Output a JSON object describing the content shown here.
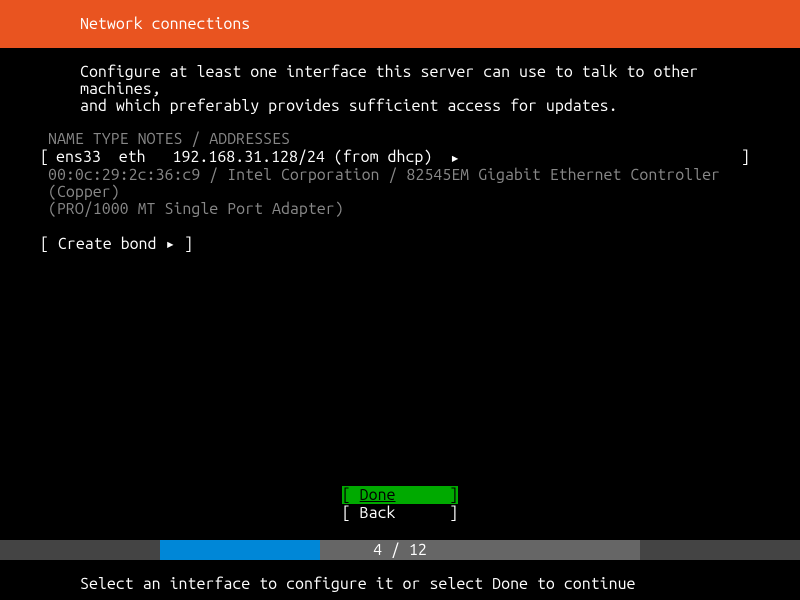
{
  "header": {
    "title": "Network connections"
  },
  "instructions": {
    "line1": "Configure at least one interface this server can use to talk to other machines,",
    "line2": "and which preferably provides sufficient access for updates."
  },
  "table": {
    "header": "NAME   TYPE  NOTES / ADDRESSES"
  },
  "interface": {
    "name": "ens33",
    "type": "eth",
    "address": "192.168.31.128/24 (from dhcp)",
    "arrow": "▸",
    "detail1": "00:0c:29:2c:36:c9 / Intel Corporation / 82545EM Gigabit Ethernet Controller (Copper)",
    "detail2": "(PRO/1000 MT Single Port Adapter)"
  },
  "bond": {
    "label": "Create bond",
    "arrow": "▸"
  },
  "buttons": {
    "done": "Done",
    "back": "Back"
  },
  "progress": {
    "current": 4,
    "total": 12,
    "text": "4 / 12"
  },
  "footer": {
    "hint": "Select an interface to configure it or select Done to continue"
  }
}
